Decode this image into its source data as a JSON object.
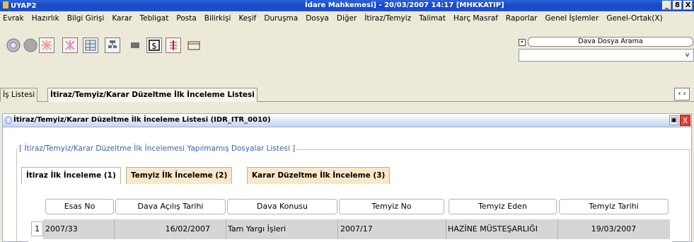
{
  "window": {
    "app_name": "UYAP2",
    "caption": "İdare Mahkemesi] - 20/03/2007 14:17 [MHKKATIP]",
    "controls": [
      "_",
      "8",
      "X"
    ]
  },
  "menu": [
    "Evrak",
    "Hazırlık",
    "Bilgi Girişi",
    "Karar",
    "Tebligat",
    "Posta",
    "Bilirkişi",
    "Keşif",
    "Duruşma",
    "Dosya",
    "Diğer",
    "İtiraz/Temyiz",
    "Talimat",
    "Harç Masraf",
    "Raporlar",
    "Genel İşlemler",
    "Genel-Ortak(X)"
  ],
  "toolbar": {
    "icons": [
      "disc-icon",
      "circle-icon",
      "pattern-icon",
      "pattern-pink-icon",
      "grid-icon",
      "tree-icon",
      "flag-icon",
      "dollar-icon",
      "ledger-icon",
      "folder-icon"
    ]
  },
  "search": {
    "toggle": "•",
    "button_label": "Dava Dosya Arama",
    "combo_arrow": "v"
  },
  "top_tabs": [
    {
      "label": "İş Listesi",
      "active": false
    },
    {
      "label": "İtiraz/Temyiz/Karar Düzeltme İlk İnceleme Listesi",
      "active": true
    }
  ],
  "nav_arrows": "‹ ›",
  "inner_window": {
    "title": "İtiraz/Temyiz/Karar Düzeltme İlk İnceleme Listesi (IDR_ITR_0010)",
    "restore": "▣",
    "close": "X"
  },
  "group": {
    "label": "[ İtiraz/Temyiz/Karar Düzeltme İlk İncelemesi Yapılmamış Dosyalar Listesi ]"
  },
  "sub_tabs": [
    {
      "label": "İtiraz İlk İnceleme (1)",
      "active": true
    },
    {
      "label": "Temyiz İlk İnceleme (2)",
      "active": false
    },
    {
      "label": "Karar Düzeltme İlk İnceleme (3)",
      "active": false
    }
  ],
  "table": {
    "columns": [
      "Esas No",
      "Dava Açılış Tarihi",
      "Dava Konusu",
      "Temyiz No",
      "Temyiz Eden",
      "Temyiz Tarihi"
    ],
    "rows": [
      {
        "num": "1",
        "cells": [
          "2007/33",
          "16/02/2007",
          "Tam Yargı İşleri",
          "2007/17",
          "HAZİNE MÜSTEŞARLIĞI",
          "19/03/2007"
        ]
      }
    ]
  },
  "colors": {
    "titlebar": "#1947c5",
    "group_label": "#3a5fb0",
    "subtab_inactive": "#f8e8c8",
    "row_selected": "#d6d6d6"
  }
}
